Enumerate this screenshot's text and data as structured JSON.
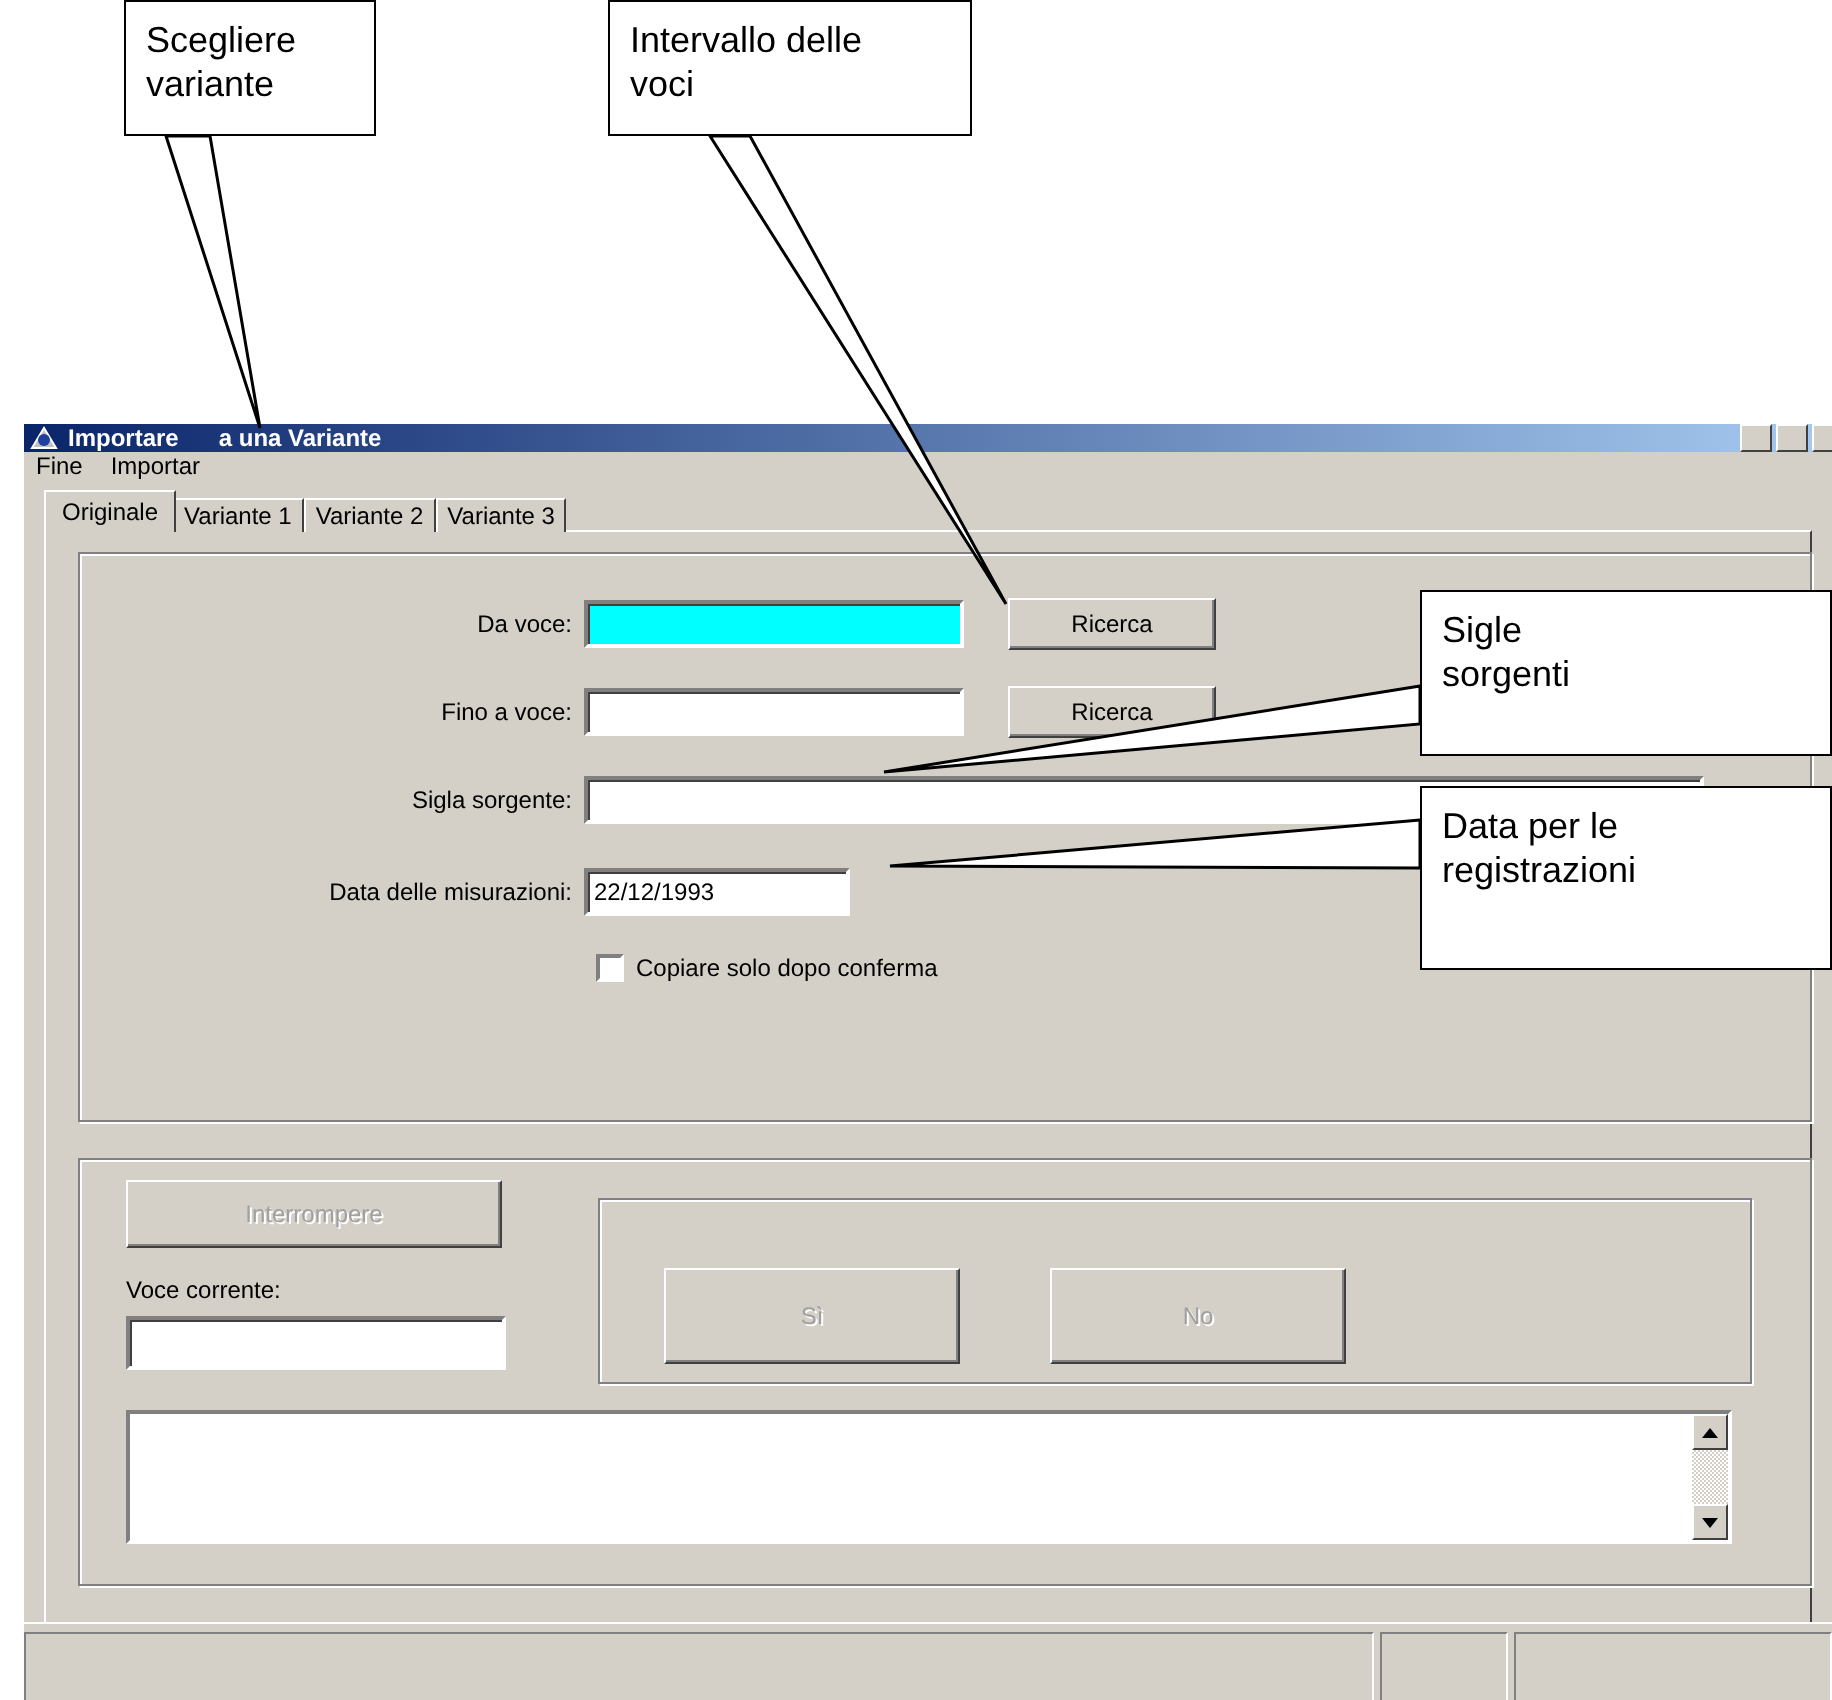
{
  "callouts": [
    {
      "text": "Scegliere variante"
    },
    {
      "text": "Intervallo delle voci"
    },
    {
      "text": "Sigle sorgenti"
    },
    {
      "text": "Data per le registrazioni"
    }
  ],
  "window": {
    "title_parts": [
      "Importare",
      "a una Variante"
    ]
  },
  "menu": [
    "Fine",
    "Importar"
  ],
  "tabs": [
    {
      "label": "Originale",
      "selected": true
    },
    {
      "label": "Variante 1",
      "selected": false
    },
    {
      "label": "Variante 2",
      "selected": false
    },
    {
      "label": "Variante 3",
      "selected": false
    }
  ],
  "form": {
    "fields": [
      {
        "label": "Da voce:",
        "highlighted": true,
        "kind": "search",
        "button": "Ricerca"
      },
      {
        "label": "Fino a voce:",
        "highlighted": false,
        "kind": "search",
        "button": "Ricerca"
      },
      {
        "label": "Sigla sorgente:",
        "highlighted": false,
        "kind": "wide"
      },
      {
        "label": "Data delle misurazioni:",
        "value": "22/12/1993",
        "highlighted": false,
        "kind": "date"
      }
    ],
    "checkbox": {
      "label": "Copiare solo dopo conferma",
      "checked": false
    }
  },
  "progress": {
    "stop_button": {
      "label": "Interrompere",
      "disabled": true
    },
    "current_label": "Voce corrente:",
    "confirm_buttons": [
      {
        "label": "Sì",
        "disabled": true
      },
      {
        "label": "No",
        "disabled": true
      }
    ]
  }
}
